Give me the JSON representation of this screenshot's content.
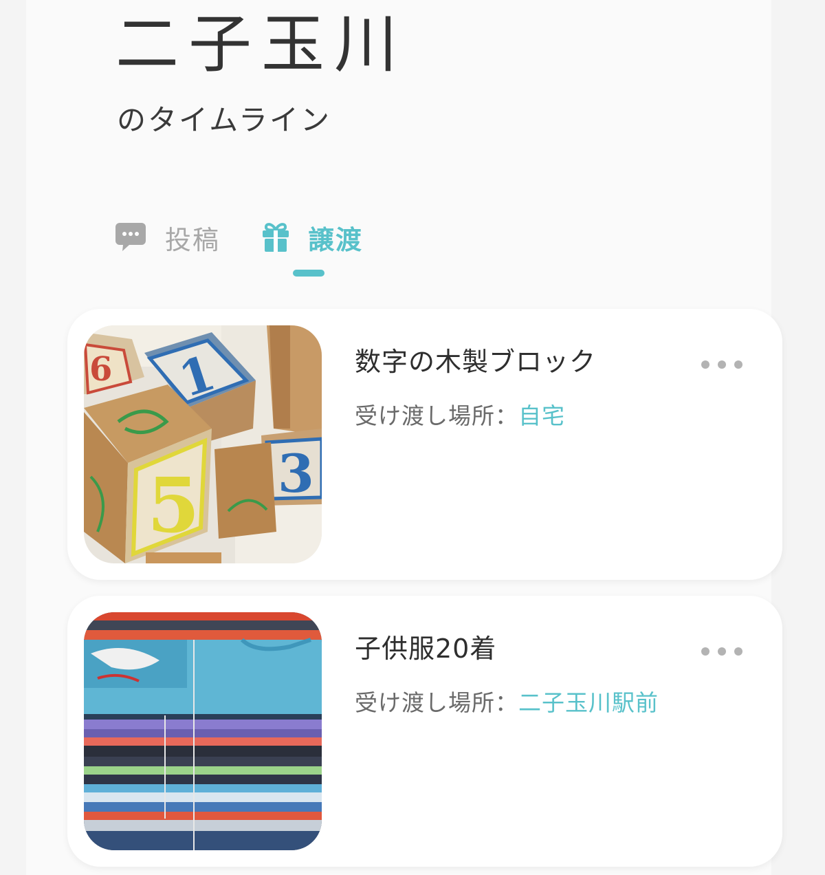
{
  "header": {
    "location_name": "二子玉川",
    "subtitle": "のタイムライン"
  },
  "tabs": [
    {
      "label": "投稿",
      "icon": "speech-bubble-icon",
      "active": false
    },
    {
      "label": "譲渡",
      "icon": "gift-icon",
      "active": true
    }
  ],
  "colors": {
    "accent": "#58c1ca",
    "inactive": "#a8a8a8",
    "text": "#333333"
  },
  "items": [
    {
      "title": "数字の木製ブロック",
      "location_label": "受け渡し場所：",
      "location_value": "自宅",
      "image": "wooden-number-blocks"
    },
    {
      "title": "子供服20着",
      "location_label": "受け渡し場所：",
      "location_value": "二子玉川駅前",
      "image": "folded-kids-clothes"
    }
  ]
}
